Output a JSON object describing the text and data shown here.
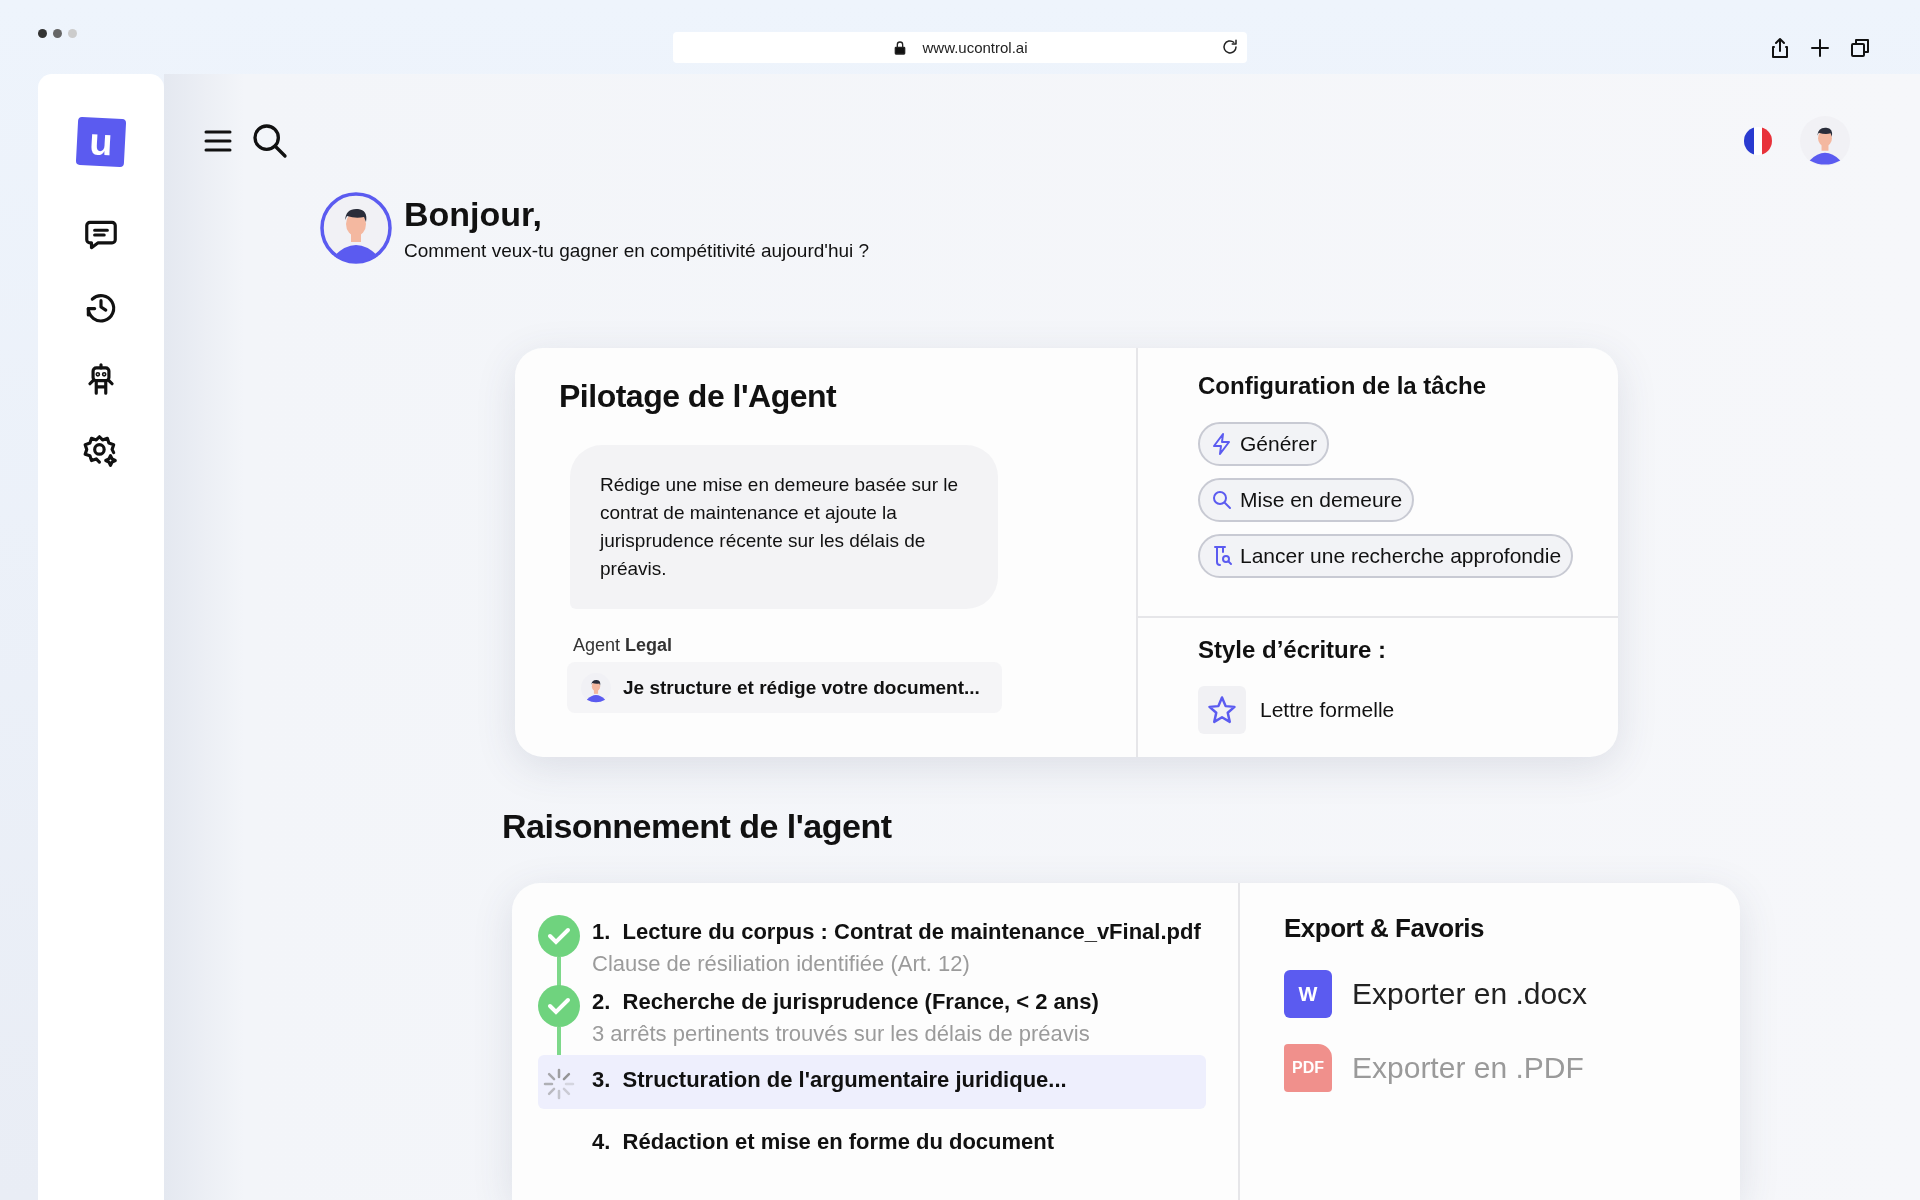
{
  "browser": {
    "url": "www.ucontrol.ai"
  },
  "sidebar": {
    "logo": "u"
  },
  "greeting": {
    "title": "Bonjour,",
    "subtitle": "Comment veux-tu gagner en compétitivité aujourd'hui ?"
  },
  "pilot": {
    "title": "Pilotage de l'Agent",
    "prompt": "Rédige une mise en demeure basée sur le contrat de maintenance et ajoute la jurisprudence récente sur les délais de préavis.",
    "agent_label": "Agent **Legal**",
    "status": "Je structure et rédige votre document..."
  },
  "config": {
    "title": "Configuration de la tâche",
    "chips": [
      {
        "label": "Générer",
        "kind": "bolt"
      },
      {
        "label": "Mise en demeure",
        "kind": "search"
      },
      {
        "label": "Lancer une recherche approfondie",
        "kind": "flask"
      }
    ],
    "style_title": "Style d’écriture :",
    "style_option": "Lettre formelle"
  },
  "reasoning": {
    "title": "Raisonnement de l'agent",
    "steps": [
      {
        "label": "1.  Lecture du corpus : Contrat de maintenance_vFinal.pdf",
        "detail": "Clause de résiliation identifiée (Art. 12)",
        "done": true,
        "active": false
      },
      {
        "label": "2.  Recherche de jurisprudence (France, < 2 ans)",
        "detail": "3 arrêts pertinents trouvés sur les délais de préavis",
        "done": true,
        "active": false
      },
      {
        "label": "3.  Structuration de l'argumentaire juridique...",
        "done": false,
        "active": true
      },
      {
        "label": "4.  Rédaction et mise en forme du document",
        "done": false,
        "active": false
      }
    ]
  },
  "export": {
    "title": "Export & Favoris",
    "items": [
      {
        "label": "Exporter en .docx",
        "kind": "docx",
        "icon_text": "W",
        "disabled": false
      },
      {
        "label": "Exporter en .PDF",
        "kind": "pdf",
        "icon_text": "PDF",
        "disabled": true
      }
    ]
  }
}
